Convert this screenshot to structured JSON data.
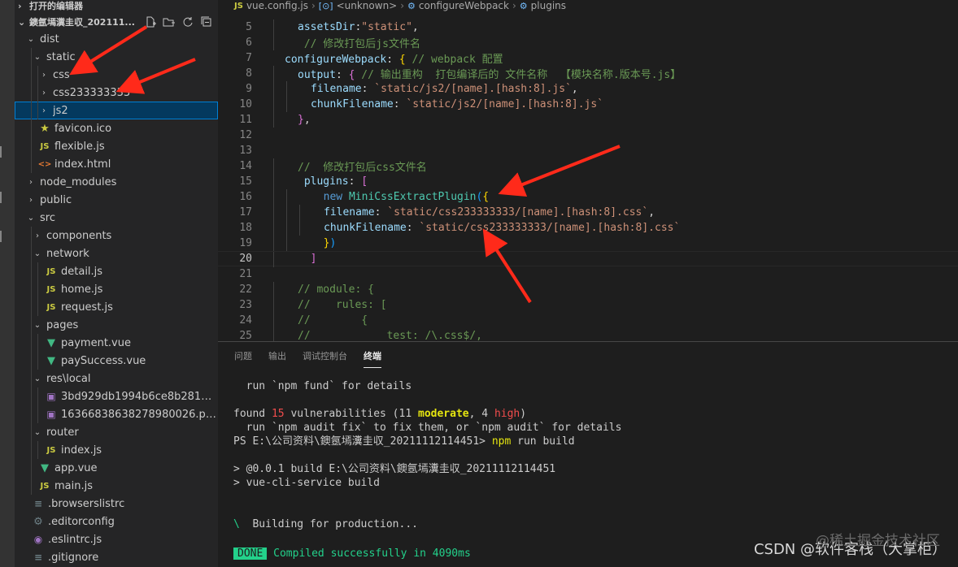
{
  "colors": {
    "arrow": "#ff2a1a",
    "selection": "#04395e",
    "accent": "#007fd4"
  },
  "sidebar": {
    "open_editors": "打开的编辑器",
    "project": "鐭氬墕瀵圭収_202111...",
    "actions": [
      "new-file-icon",
      "new-folder-icon",
      "refresh-icon",
      "collapse-all-icon"
    ],
    "items": [
      {
        "label": "dist",
        "depth": 1,
        "type": "folder",
        "open": true
      },
      {
        "label": "static",
        "depth": 2,
        "type": "folder",
        "open": true
      },
      {
        "label": "css",
        "depth": 3,
        "type": "folder",
        "open": false
      },
      {
        "label": "css233333333",
        "depth": 3,
        "type": "folder",
        "open": false
      },
      {
        "label": "js2",
        "depth": 3,
        "type": "folder",
        "open": false,
        "selected": true
      },
      {
        "label": "favicon.ico",
        "depth": 2,
        "type": "star"
      },
      {
        "label": "flexible.js",
        "depth": 2,
        "type": "js"
      },
      {
        "label": "index.html",
        "depth": 2,
        "type": "html"
      },
      {
        "label": "node_modules",
        "depth": 1,
        "type": "folder",
        "open": false
      },
      {
        "label": "public",
        "depth": 1,
        "type": "folder",
        "open": false
      },
      {
        "label": "src",
        "depth": 1,
        "type": "folder",
        "open": true
      },
      {
        "label": "components",
        "depth": 2,
        "type": "folder",
        "open": false
      },
      {
        "label": "network",
        "depth": 2,
        "type": "folder",
        "open": true
      },
      {
        "label": "detail.js",
        "depth": 3,
        "type": "js"
      },
      {
        "label": "home.js",
        "depth": 3,
        "type": "js"
      },
      {
        "label": "request.js",
        "depth": 3,
        "type": "js"
      },
      {
        "label": "pages",
        "depth": 2,
        "type": "folder",
        "open": true
      },
      {
        "label": "payment.vue",
        "depth": 3,
        "type": "vue"
      },
      {
        "label": "paySuccess.vue",
        "depth": 3,
        "type": "vue"
      },
      {
        "label": "res\\local",
        "depth": 2,
        "type": "folder",
        "open": true
      },
      {
        "label": "3bd929db1994b6ce8b28182db0...",
        "depth": 3,
        "type": "img"
      },
      {
        "label": "1636683863827898002​6.png",
        "depth": 3,
        "type": "img"
      },
      {
        "label": "router",
        "depth": 2,
        "type": "folder",
        "open": true
      },
      {
        "label": "index.js",
        "depth": 3,
        "type": "js"
      },
      {
        "label": "app.vue",
        "depth": 2,
        "type": "vue"
      },
      {
        "label": "main.js",
        "depth": 2,
        "type": "js"
      },
      {
        "label": ".browserslistrc",
        "depth": 1,
        "type": "dim"
      },
      {
        "label": ".editorconfig",
        "depth": 1,
        "type": "gear"
      },
      {
        "label": ".eslintrc.js",
        "depth": 1,
        "type": "circ"
      },
      {
        "label": ".gitignore",
        "depth": 1,
        "type": "dim"
      }
    ]
  },
  "breadcrumb": {
    "file": "vue.config.js",
    "file_icon": "JS",
    "crumbs": [
      "<unknown>",
      "configureWebpack",
      "plugins"
    ]
  },
  "editor": {
    "active_line": "20",
    "lines": [
      {
        "n": "5",
        "indent": 1,
        "tokens": [
          [
            "t-prop",
            "assetsDir"
          ],
          [
            "t-pun",
            ":"
          ],
          [
            "t-str",
            "\"static\""
          ],
          [
            "t-pun",
            ","
          ]
        ]
      },
      {
        "n": "6",
        "indent": 1,
        "tokens": [
          [
            "t-com",
            " // 修改打包后js文件名"
          ]
        ]
      },
      {
        "n": "7",
        "indent": 0,
        "tokens": [
          [
            "t-prop",
            "configureWebpack"
          ],
          [
            "t-pun",
            ": "
          ],
          [
            "t-br",
            "{"
          ],
          [
            "t-com",
            " // webpack 配置"
          ]
        ]
      },
      {
        "n": "8",
        "indent": 1,
        "tokens": [
          [
            "t-prop",
            "output"
          ],
          [
            "t-pun",
            ": "
          ],
          [
            "t-br2",
            "{"
          ],
          [
            "t-com",
            " // 输出重构  打包编译后的 文件名称  【模块名称.版本号.js】"
          ]
        ]
      },
      {
        "n": "9",
        "indent": 2,
        "tokens": [
          [
            "t-prop",
            "filename"
          ],
          [
            "t-pun",
            ": "
          ],
          [
            "t-str",
            "`static/js2/[name].[hash:8].js`"
          ],
          [
            "t-pun",
            ","
          ]
        ]
      },
      {
        "n": "10",
        "indent": 2,
        "tokens": [
          [
            "t-prop",
            "chunkFilename"
          ],
          [
            "t-pun",
            ": "
          ],
          [
            "t-str",
            "`static/js2/[name].[hash:8].js`"
          ]
        ]
      },
      {
        "n": "11",
        "indent": 1,
        "tokens": [
          [
            "t-br2",
            "}"
          ],
          [
            "t-pun",
            ","
          ]
        ]
      },
      {
        "n": "12",
        "indent": 0,
        "tokens": []
      },
      {
        "n": "13",
        "indent": 0,
        "tokens": []
      },
      {
        "n": "14",
        "indent": 1,
        "tokens": [
          [
            "t-com",
            "//  修改打包后css文件名"
          ]
        ]
      },
      {
        "n": "15",
        "indent": 1,
        "tokens": [
          [
            "t-pun",
            " "
          ],
          [
            "t-prop",
            "plugins"
          ],
          [
            "t-pun",
            ": "
          ],
          [
            "t-br2",
            "["
          ]
        ]
      },
      {
        "n": "16",
        "indent": 2,
        "tokens": [
          [
            "t-pun",
            "  "
          ],
          [
            "t-kw",
            "new "
          ],
          [
            "t-cls",
            "MiniCssExtractPlugin"
          ],
          [
            "t-br3",
            "("
          ],
          [
            "t-br",
            "{"
          ]
        ]
      },
      {
        "n": "17",
        "indent": 3,
        "tokens": [
          [
            "t-prop",
            "filename"
          ],
          [
            "t-pun",
            ": "
          ],
          [
            "t-str",
            "`static/css233333333/[name].[hash:8].css`"
          ],
          [
            "t-pun",
            ","
          ]
        ]
      },
      {
        "n": "18",
        "indent": 3,
        "tokens": [
          [
            "t-prop",
            "chunkFilename"
          ],
          [
            "t-pun",
            ": "
          ],
          [
            "t-str",
            "`static/css233333333/[name].[hash:8].css`"
          ]
        ]
      },
      {
        "n": "19",
        "indent": 2,
        "tokens": [
          [
            "t-pun",
            "  "
          ],
          [
            "t-br",
            "}"
          ],
          [
            "t-br3",
            ")"
          ]
        ]
      },
      {
        "n": "20",
        "indent": 1,
        "tokens": [
          [
            "t-pun",
            "  "
          ],
          [
            "t-br2",
            "]"
          ]
        ]
      },
      {
        "n": "21",
        "indent": 0,
        "tokens": []
      },
      {
        "n": "22",
        "indent": 1,
        "tokens": [
          [
            "t-com",
            "// module: {"
          ]
        ]
      },
      {
        "n": "23",
        "indent": 1,
        "tokens": [
          [
            "t-com",
            "//    rules: ["
          ]
        ]
      },
      {
        "n": "24",
        "indent": 1,
        "tokens": [
          [
            "t-com",
            "//        {"
          ]
        ]
      },
      {
        "n": "25",
        "indent": 1,
        "tokens": [
          [
            "t-com",
            "//            test: /\\.css$/,"
          ]
        ]
      }
    ]
  },
  "panel": {
    "tabs": [
      "问题",
      "输出",
      "调试控制台",
      "终端"
    ],
    "active_tab": "终端",
    "terminal": {
      "l1": "  run `npm fund` for details",
      "l3_a": "found ",
      "l3_num": "15",
      "l3_b": " vulnerabilities (11 ",
      "l3_mod": "moderate",
      "l3_c": ", 4 ",
      "l3_high": "high",
      "l3_d": ")",
      "l4": "  run `npm audit fix` to fix them, or `npm audit` for details",
      "l5_a": "PS E:\\公司资料\\鐭氬墕瀵圭収_20211112114451> ",
      "l5_cmd": "npm",
      "l5_b": " run build",
      "l7": "> @0.0.1 build E:\\公司资料\\鐭氬墕瀵圭収_20211112114451",
      "l8": "> vue-cli-service build",
      "l11_spin": "\\",
      "l11": "  Building for production...",
      "l13_done": "DONE",
      "l13": " Compiled successfully in 4090ms"
    },
    "watermark": "CSDN @软件客栈（大掌柜）",
    "watermark2": "@稀土掘金技术社区"
  }
}
